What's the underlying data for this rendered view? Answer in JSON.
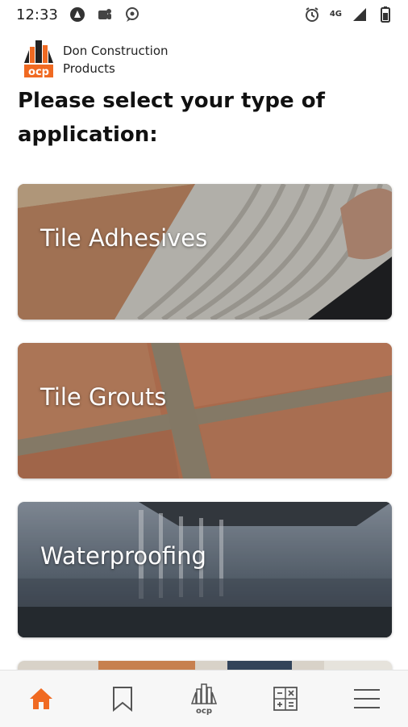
{
  "status": {
    "time": "12:33",
    "network": "4G"
  },
  "brand": {
    "line1": "Don Construction",
    "line2": "Products"
  },
  "page": {
    "title": "Please select your type of application:"
  },
  "applications": [
    {
      "label": "Tile Adhesives"
    },
    {
      "label": "Tile Grouts"
    },
    {
      "label": "Waterproofing"
    }
  ],
  "colors": {
    "accent": "#f06a22",
    "icon_gray": "#555555"
  },
  "icons": {
    "nav_home": "home-icon",
    "nav_bookmark": "bookmark-icon",
    "nav_logo": "ocp-logo-icon",
    "nav_calculator": "calculator-icon",
    "nav_menu": "menu-icon"
  }
}
